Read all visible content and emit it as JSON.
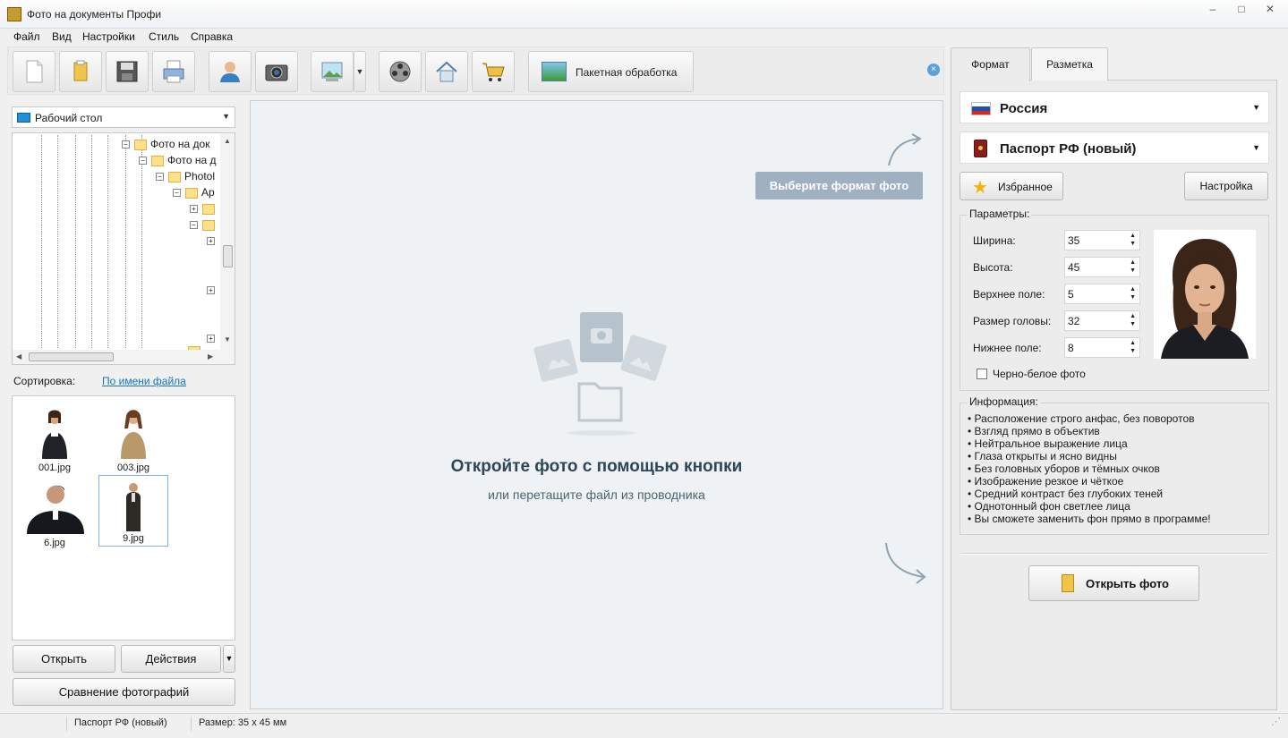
{
  "window": {
    "title": "Фото на документы Профи",
    "controls": [
      "–",
      "□",
      "✕"
    ]
  },
  "menu": [
    "Файл",
    "Вид",
    "Настройки",
    "Стиль",
    "Справка"
  ],
  "toolbar": {
    "batch_label": "Пакетная обработка",
    "buttons": [
      "new-document-icon",
      "open-folder-icon",
      "save-icon",
      "print-icon",
      "user-icon",
      "camera-icon",
      "image-effects-icon",
      "film-reel-icon",
      "home-icon",
      "cart-icon"
    ]
  },
  "left": {
    "folder_selected": "Рабочий стол",
    "tree": [
      "Фото на док",
      "Фото на д",
      "Photol",
      "Ap"
    ],
    "sort_label": "Сортировка:",
    "sort_value": "По имени файла",
    "files": [
      {
        "name": "001.jpg",
        "selected": false
      },
      {
        "name": "003.jpg",
        "selected": false
      },
      {
        "name": "6.jpg",
        "selected": false
      },
      {
        "name": "9.jpg",
        "selected": true
      }
    ],
    "open_button": "Открыть",
    "actions_button": "Действия",
    "compare_button": "Сравнение фотографий"
  },
  "center": {
    "choose_format": "Выберите формат фото",
    "title": "Откройте фото с помощью кнопки",
    "subtitle": "или перетащите файл из проводника"
  },
  "right": {
    "tabs": [
      "Формат",
      "Разметка"
    ],
    "active_tab": "Формат",
    "country": "Россия",
    "document": "Паспорт РФ (новый)",
    "favorites_button": "Избранное",
    "settings_button": "Настройка",
    "params_title": "Параметры:",
    "params": [
      {
        "label": "Ширина:",
        "value": "35"
      },
      {
        "label": "Высота:",
        "value": "45"
      },
      {
        "label": "Верхнее поле:",
        "value": "5"
      },
      {
        "label": "Размер головы:",
        "value": "32"
      },
      {
        "label": "Нижнее поле:",
        "value": "8"
      }
    ],
    "bw_label": "Черно-белое фото",
    "bw_checked": false,
    "info_title": "Информация:",
    "info": [
      "Расположение строго анфас, без поворотов",
      "Взгляд прямо в объектив",
      "Нейтральное выражение лица",
      "Глаза открыты и ясно видны",
      "Без головных уборов и тёмных очков",
      "Изображение резкое и чёткое",
      "Средний контраст без глубоких теней",
      "Однотонный фон светлее лица",
      "Вы сможете заменить фон прямо в программе!"
    ],
    "open_photo_button": "Открыть фото"
  },
  "status": {
    "document": "Паспорт РФ (новый)",
    "size": "Размер: 35 x 45 мм"
  },
  "colors": {
    "accent_link": "#1a73c2",
    "hint_badge": "#9fb1c0",
    "center_bg": "#eff2f4",
    "title_text": "#2e4756"
  }
}
